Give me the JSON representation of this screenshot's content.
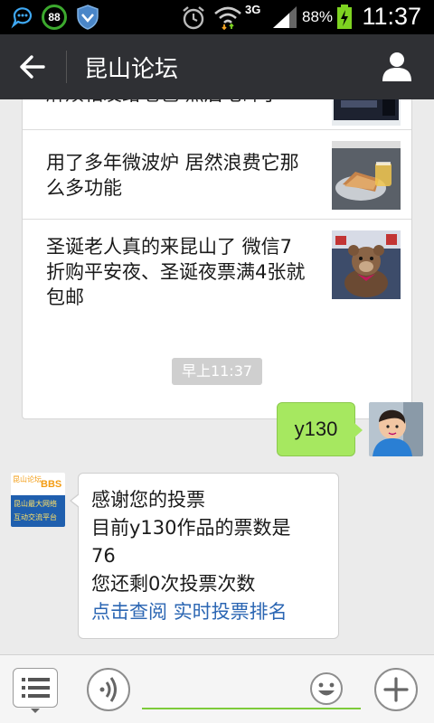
{
  "status_bar": {
    "network_type": "3G",
    "battery_percent": "88%",
    "time": "11:37",
    "notification_badge": "88"
  },
  "header": {
    "title": "昆山论坛"
  },
  "news_card": {
    "items": [
      {
        "title": "麻烦相发给老爸 然后宅碎了"
      },
      {
        "title": "用了多年微波炉 居然浪费它那么多功能"
      },
      {
        "title": "圣诞老人真的来昆山了 微信7折购平安夜、圣诞夜票满4张就包邮"
      }
    ]
  },
  "chat": {
    "timestamp": "早上11:37",
    "outgoing_message": "y130",
    "incoming": {
      "avatar_lines": [
        "昆山论坛",
        "BBS",
        "昆山最大网络",
        "互动交流平台"
      ],
      "lines": [
        "感谢您的投票",
        "目前y130作品的票数是",
        "76",
        "您还剩0次投票次数"
      ],
      "link_1": "点击查阅",
      "link_2": "实时投票排名"
    }
  },
  "input_bar": {
    "input_value": ""
  },
  "colors": {
    "accent_green": "#a6e860",
    "title_bar": "#2f3034",
    "link": "#2b66b3"
  }
}
